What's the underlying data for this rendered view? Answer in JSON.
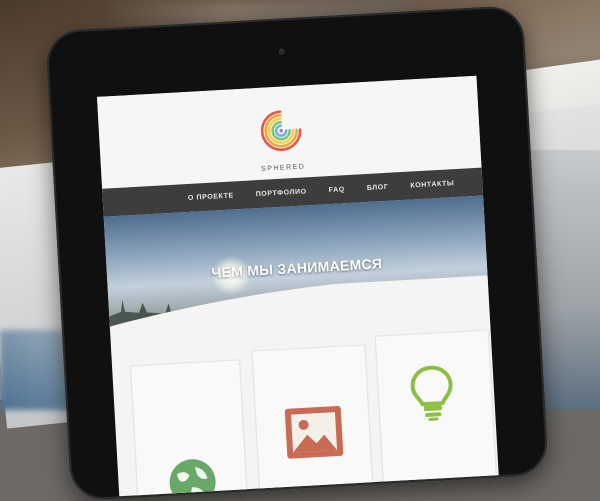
{
  "site": {
    "logo_text": "SPHERED"
  },
  "nav": {
    "items": [
      {
        "label": "О ПРОЕКТЕ"
      },
      {
        "label": "ПОРТФОЛИО"
      },
      {
        "label": "FAQ"
      },
      {
        "label": "БЛОГ"
      },
      {
        "label": "КОНТАКТЫ"
      }
    ]
  },
  "hero": {
    "title": "ЧЕМ МЫ ЗАНИМАЕМСЯ"
  },
  "cards": [
    {
      "icon": "globe-icon",
      "color": "#6aa86a"
    },
    {
      "icon": "picture-icon",
      "color": "#c96a55"
    },
    {
      "icon": "lightbulb-icon",
      "color": "#8fbe45"
    }
  ],
  "colors": {
    "nav_bg": "#3d3d3d",
    "logo_rings": [
      "#e0584a",
      "#f0a640",
      "#f3d34b",
      "#7fc27a",
      "#6cb5d8",
      "#a57ac7"
    ]
  }
}
